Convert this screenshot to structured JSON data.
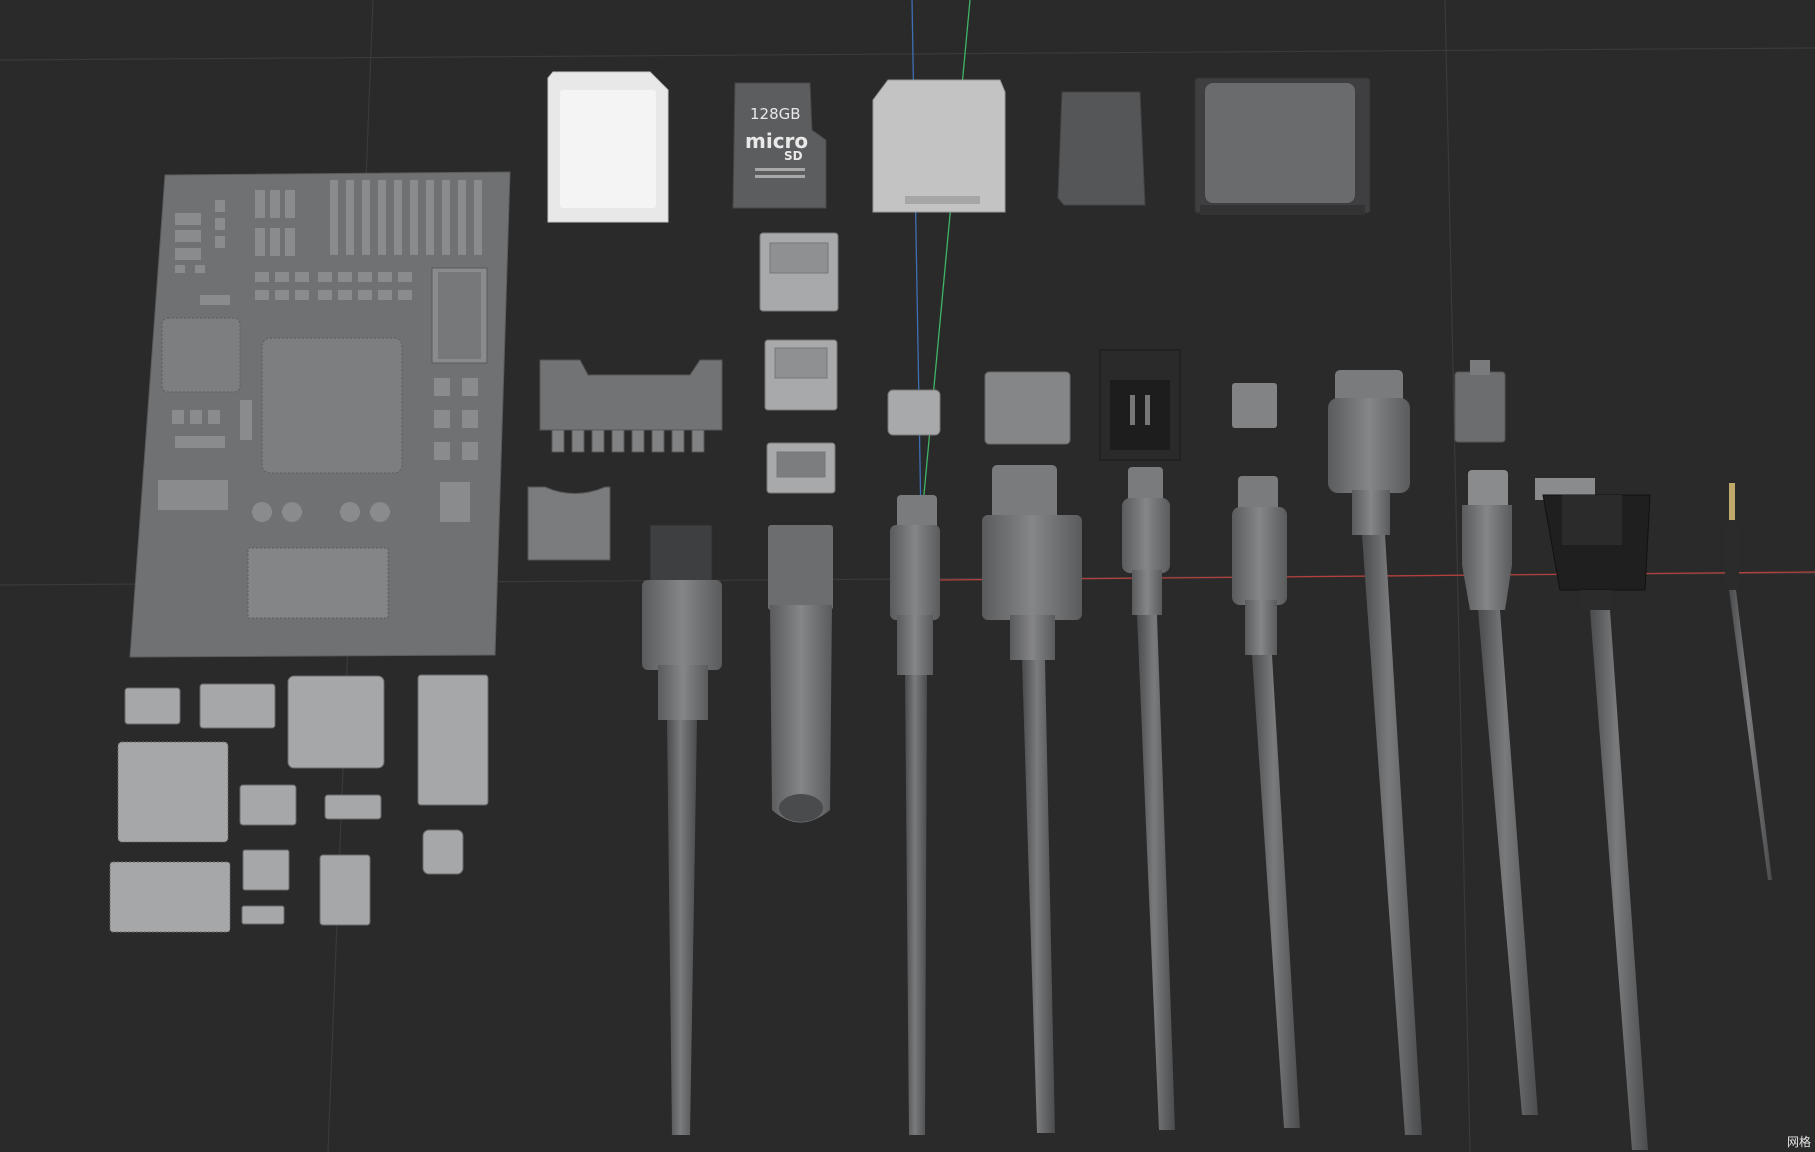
{
  "viewport": {
    "background": "#2a2a2a",
    "grid_color": "#3a3a3a",
    "axis_x_color": "#b3403c",
    "axis_y_color": "#3e6fb5",
    "axis_z_color": "#3fb567",
    "model_color": "#6e6f71",
    "model_light": "#8b8c8e",
    "card_white": "#e8e8e8",
    "corner_label": "网格"
  },
  "microsd": {
    "capacity": "128GB",
    "brand": "micro",
    "brand_suffix": "SD"
  },
  "icons": [
    "pcb-board-model",
    "sd-card-model",
    "microsd-card-model",
    "usb-port-model",
    "cable-model"
  ]
}
